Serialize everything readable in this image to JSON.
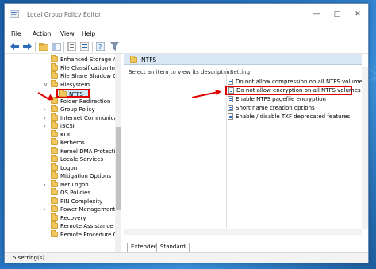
{
  "window": {
    "title": "Local Group Policy Editor",
    "controls": {
      "minimize": "—",
      "maximize": "□",
      "close": "✕"
    }
  },
  "menu": [
    "File",
    "Action",
    "View",
    "Help"
  ],
  "toolbar": {
    "icons": [
      "back-arrow-icon",
      "forward-arrow-icon",
      "up-folder-icon",
      "show-hide-tree-icon",
      "properties-icon",
      "export-list-icon",
      "help-icon",
      "filter-icon"
    ]
  },
  "tree": {
    "items": [
      {
        "label": "Enhanced Storage Ac",
        "expander": ""
      },
      {
        "label": "File Classification Inf",
        "expander": ""
      },
      {
        "label": "File Share Shadow C",
        "expander": ""
      },
      {
        "label": "Filesystem",
        "expander": "∨"
      },
      {
        "label": "NTFS",
        "expander": ""
      },
      {
        "label": "Folder Redirection",
        "expander": ""
      },
      {
        "label": "Group Policy",
        "expander": "›"
      },
      {
        "label": "Internet Communica",
        "expander": "›"
      },
      {
        "label": "iSCSI",
        "expander": "›"
      },
      {
        "label": "KDC",
        "expander": ""
      },
      {
        "label": "Kerberos",
        "expander": ""
      },
      {
        "label": "Kernel DMA Protectio",
        "expander": ""
      },
      {
        "label": "Locale Services",
        "expander": ""
      },
      {
        "label": "Logon",
        "expander": ""
      },
      {
        "label": "Mitigation Options",
        "expander": ""
      },
      {
        "label": "Net Logon",
        "expander": "›"
      },
      {
        "label": "OS Policies",
        "expander": ""
      },
      {
        "label": "PIN Complexity",
        "expander": ""
      },
      {
        "label": "Power Management",
        "expander": "›"
      },
      {
        "label": "Recovery",
        "expander": ""
      },
      {
        "label": "Remote Assistance",
        "expander": ""
      },
      {
        "label": "Remote Procedure C",
        "expander": ""
      }
    ]
  },
  "details": {
    "header": "NTFS",
    "description": "Select an item to view its description.",
    "column": "Setting",
    "settings": [
      "Do not allow compression on all NTFS volumes",
      "Do not allow encryption on all NTFS volumes",
      "Enable NTFS pagefile encryption",
      "Short name creation options",
      "Enable / disable TXF deprecated features"
    ],
    "tabs": [
      "Extended",
      "Standard"
    ]
  },
  "status": "5 setting(s)"
}
